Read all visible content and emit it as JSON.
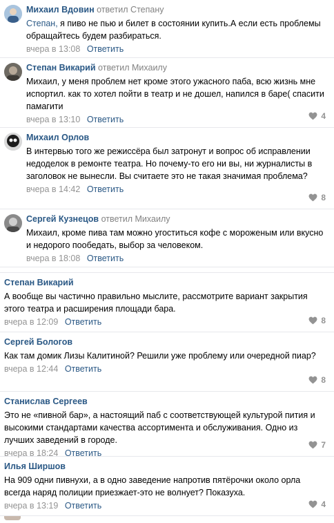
{
  "icons": {
    "like": "heart-icon"
  },
  "colors": {
    "link": "#2a5885",
    "meta": "#939393",
    "separator": "#e7e8ec"
  },
  "comments": [
    {
      "author": "Михаил Вдовин",
      "replied_label": "ответил",
      "replied_to": "Степану",
      "mention": "Степан,",
      "text": " я пиво не пью и билет в состоянии купить.А если есть проблемы обращайтесь будем разбираться.",
      "time": "вчера в 13:08",
      "reply": "Ответить",
      "likes": ""
    },
    {
      "author": "Степан Викарий",
      "replied_label": "ответил",
      "replied_to": "Михаилу",
      "mention": "",
      "text": "Михаил, у меня проблем нет кроме этого ужасного паба, всю жизнь мне испортил. как то хотел пойти в театр и не дошел, напился в баре( спасити памагити",
      "time": "вчера в 13:10",
      "reply": "Ответить",
      "likes": "4"
    },
    {
      "author": "Михаил Орлов",
      "replied_label": "",
      "replied_to": "",
      "mention": "",
      "text": "В интервью того же режиссёра был затронут и вопрос об исправлении недоделок в ремонте театра. Но почему-то его ни вы, ни журналисты в заголовок не вынесли. Вы считаете это не такая значимая проблема?",
      "time": "вчера в 14:42",
      "reply": "Ответить",
      "likes": "8"
    },
    {
      "author": "Сергей Кузнецов",
      "replied_label": "ответил",
      "replied_to": "Михаилу",
      "mention": "",
      "text": "Михаил, кроме пива там можно угоститься кофе с мороженым или вкусно и недорого пообедать, выбор за человеком.",
      "time": "вчера в 18:08",
      "reply": "Ответить",
      "likes": ""
    },
    {
      "author": "Степан Викарий",
      "replied_label": "",
      "replied_to": "",
      "mention": "",
      "text": "А вообще вы частично правильно мыслите, рассмотрите вариант закрытия этого театра и расширения площади бара.",
      "time": "вчера в 12:09",
      "reply": "Ответить",
      "likes": "8"
    },
    {
      "author": "Сергей Бологов",
      "replied_label": "",
      "replied_to": "",
      "mention": "",
      "text": "Как там домик Лизы Калитиной? Решили уже проблему или очередной пиар?",
      "time": "вчера в 12:44",
      "reply": "Ответить",
      "likes": "8"
    },
    {
      "author": "Станислав Сергеев",
      "replied_label": "",
      "replied_to": "",
      "mention": "",
      "text": "Это не «пивной бар», а настоящий паб с соответствующей культурой пития и высокими стандартами качества ассортимента и обслуживания. Одно из лучших заведений в городе.",
      "time": "вчера в 18:24",
      "reply": "Ответить",
      "likes": "7"
    },
    {
      "author": "Илья Ширшов",
      "replied_label": "",
      "replied_to": "",
      "mention": "",
      "text": "На 909 одни пивнухи, а в одно заведение напротив пятёрочки около орла всегда наряд полиции приезжает-это не волнует? Показуха.",
      "time": "вчера в 13:19",
      "reply": "Ответить",
      "likes": "4"
    }
  ]
}
